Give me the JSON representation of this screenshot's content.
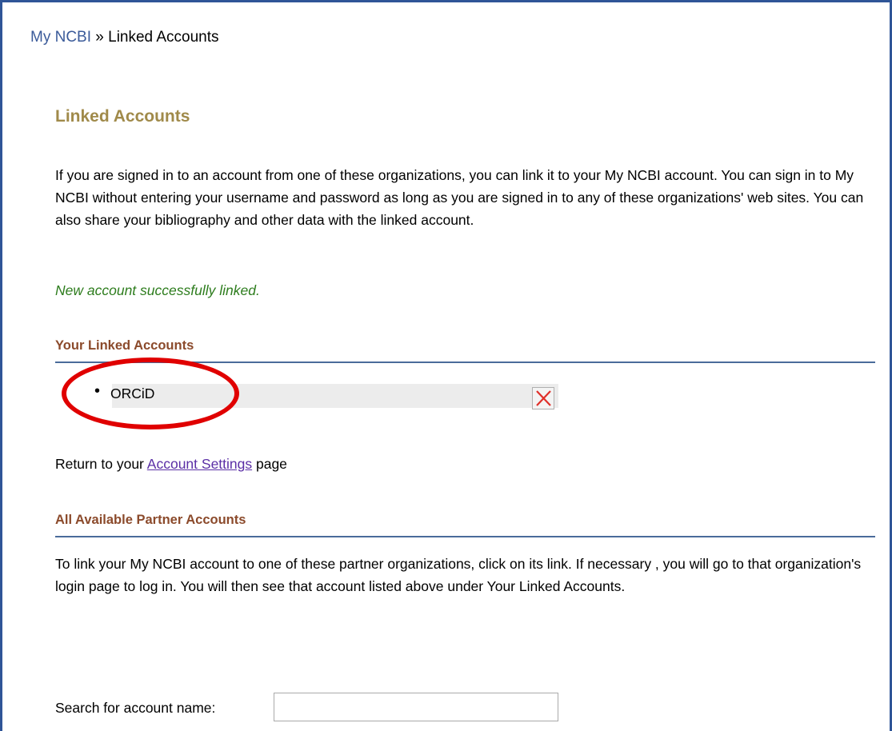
{
  "breadcrumb": {
    "root": "My NCBI",
    "separator": " » ",
    "current": "Linked Accounts"
  },
  "page_title": "Linked Accounts",
  "intro_text": "If you are signed in to an account from one of these organizations, you can link it to your My NCBI account. You can sign in to My NCBI without entering your username and password as long as you are signed in to any of these organizations' web sites. You can also share your bibliography and other data with the linked account.",
  "success_message": "New account successfully linked.",
  "your_linked": {
    "heading": "Your Linked Accounts",
    "items": [
      {
        "bullet": "•",
        "name": "ORCiD",
        "remove_icon": "close-x-icon"
      }
    ]
  },
  "return_line": {
    "prefix": "Return to your ",
    "link": "Account Settings",
    "suffix": " page"
  },
  "partners": {
    "heading": "All Available Partner Accounts",
    "intro": "To link your My NCBI account to one of these partner organizations, click on its link. If necessary , you will go to that organization's login page to log in. You will then see that account listed above under Your Linked Accounts."
  },
  "search": {
    "label": "Search for account name:",
    "value": "",
    "placeholder": ""
  },
  "colors": {
    "frame_border": "#2f5597",
    "title": "#a08a4a",
    "section_heading": "#8b4a2b",
    "success": "#2e7d1e",
    "highlight": "#e00000"
  }
}
